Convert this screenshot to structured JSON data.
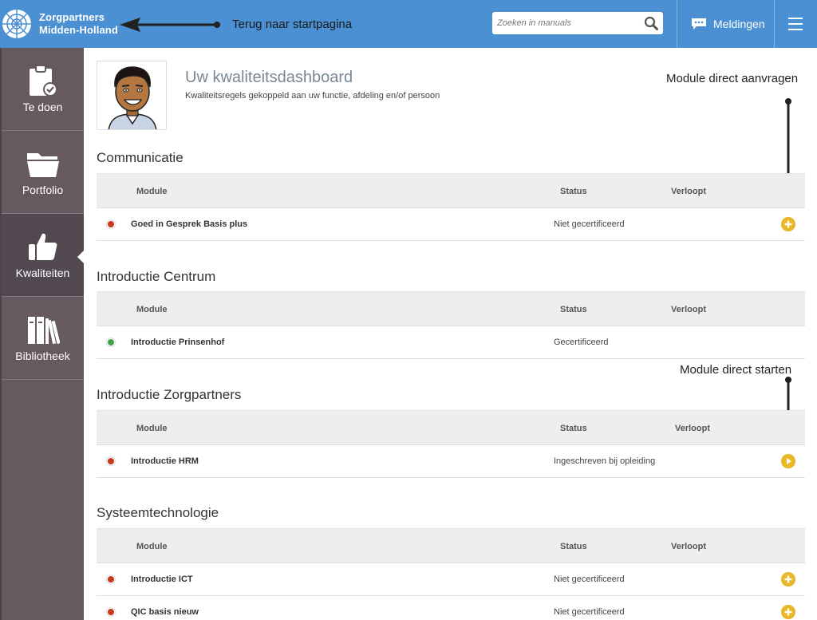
{
  "header": {
    "logo_line1": "Zorgpartners",
    "logo_line2": "Midden-Holland",
    "back_annotation": "Terug naar startpagina",
    "search_placeholder": "Zoeken in manuals",
    "notifications_label": "Meldingen",
    "accent_color": "#4a90d2"
  },
  "sidebar": {
    "items": [
      {
        "label": "Te doen",
        "icon": "clipboard-check-icon"
      },
      {
        "label": "Portfolio",
        "icon": "folder-icon"
      },
      {
        "label": "Kwaliteiten",
        "icon": "thumbs-up-icon",
        "active": true
      },
      {
        "label": "Bibliotheek",
        "icon": "books-icon"
      }
    ]
  },
  "dashboard": {
    "title": "Uw kwaliteitsdashboard",
    "subtitle": "Kwaliteitsregels gekoppeld aan uw functie, afdeling en/of persoon",
    "annotation_request": "Module direct aanvragen",
    "annotation_start": "Module direct starten"
  },
  "columns": {
    "module": "Module",
    "status": "Status",
    "expires": "Verloopt"
  },
  "sections": [
    {
      "title": "Communicatie",
      "rows": [
        {
          "dot": "red",
          "name": "Goed in Gesprek Basis plus",
          "status": "Niet gecertificeerd",
          "action": "plus"
        }
      ]
    },
    {
      "title": "Introductie Centrum",
      "rows": [
        {
          "dot": "green",
          "name": "Introductie Prinsenhof",
          "status": "Gecertificeerd",
          "action": ""
        }
      ]
    },
    {
      "title": "Introductie Zorgpartners",
      "rows": [
        {
          "dot": "red",
          "name": "Introductie HRM",
          "status": "Ingeschreven bij opleiding",
          "action": "play"
        }
      ]
    },
    {
      "title": "Systeemtechnologie",
      "rows": [
        {
          "dot": "red",
          "name": "Introductie ICT",
          "status": "Niet gecertificeerd",
          "action": "plus"
        },
        {
          "dot": "red",
          "name": "QIC basis nieuw",
          "status": "Niet gecertificeerd",
          "action": "plus"
        }
      ]
    }
  ]
}
